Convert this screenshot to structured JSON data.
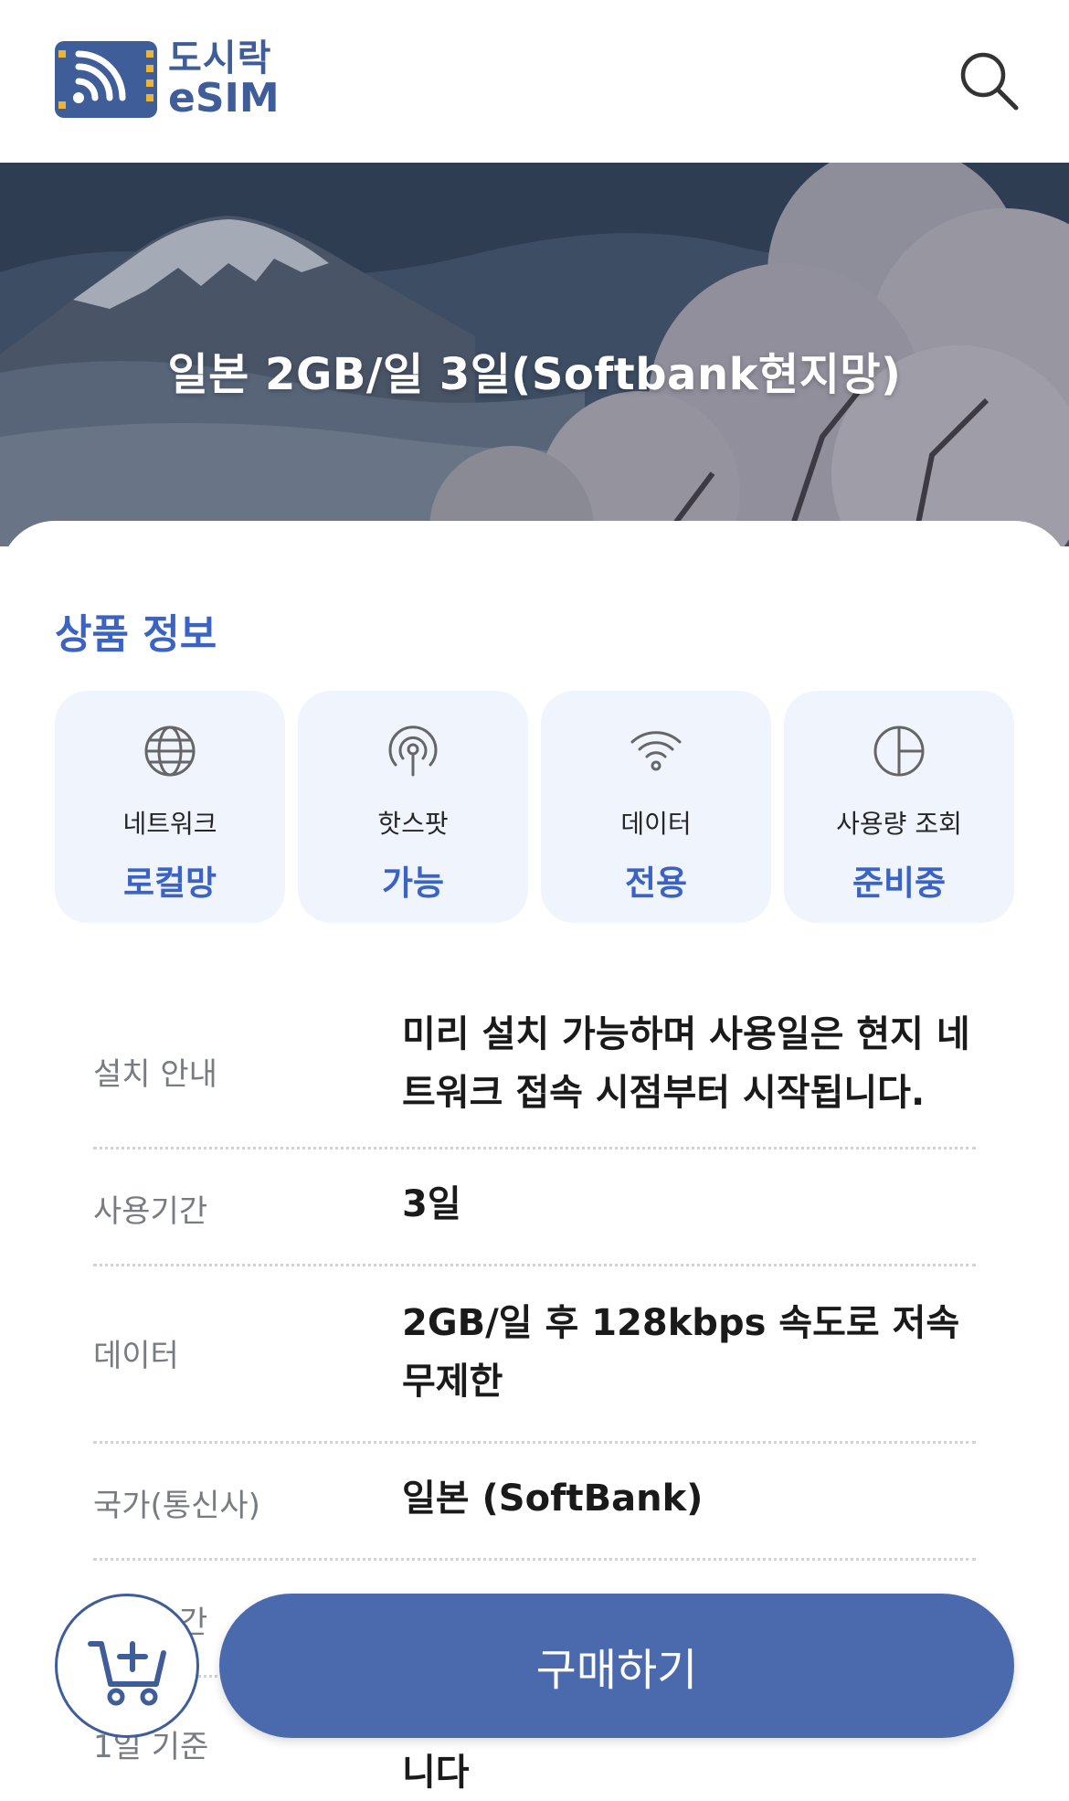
{
  "header": {
    "logo_line1": "도시락",
    "logo_line2": "eSIM",
    "logo_icon": "sim-wifi-logo-icon",
    "search_icon": "search-icon"
  },
  "hero": {
    "title": "일본 2GB/일 3일(Softbank현지망)"
  },
  "product_info": {
    "section_title": "상품 정보",
    "cards": [
      {
        "icon": "globe-icon",
        "label": "네트워크",
        "value": "로컬망"
      },
      {
        "icon": "hotspot-icon",
        "label": "핫스팟",
        "value": "가능"
      },
      {
        "icon": "wifi-icon",
        "label": "데이터",
        "value": "전용"
      },
      {
        "icon": "pie-chart-icon",
        "label": "사용량 조회",
        "value": "준비중"
      }
    ],
    "rows": [
      {
        "label": "설치 안내",
        "value": "미리 설치 가능하며 사용일은 현지 네트워크 접속 시점부터 시작됩니다."
      },
      {
        "label": "사용기간",
        "value": "3일"
      },
      {
        "label": "데이터",
        "value": "2GB/일 후 128kbps 속도로 저속 무제한"
      },
      {
        "label": "국가(통신사)",
        "value": "일본 (SoftBank)"
      },
      {
        "label": "간",
        "value": ""
      },
      {
        "label": "1일 기준",
        "value": "한국시간 자정 기준으로 1일 계산합니다"
      }
    ]
  },
  "actions": {
    "cart_icon": "add-to-cart-icon",
    "buy_label": "구매하기"
  },
  "colors": {
    "brand": "#3f5d99",
    "accent": "#3a63c4",
    "button": "#4b6aae",
    "card_bg": "#f0f4fd"
  }
}
